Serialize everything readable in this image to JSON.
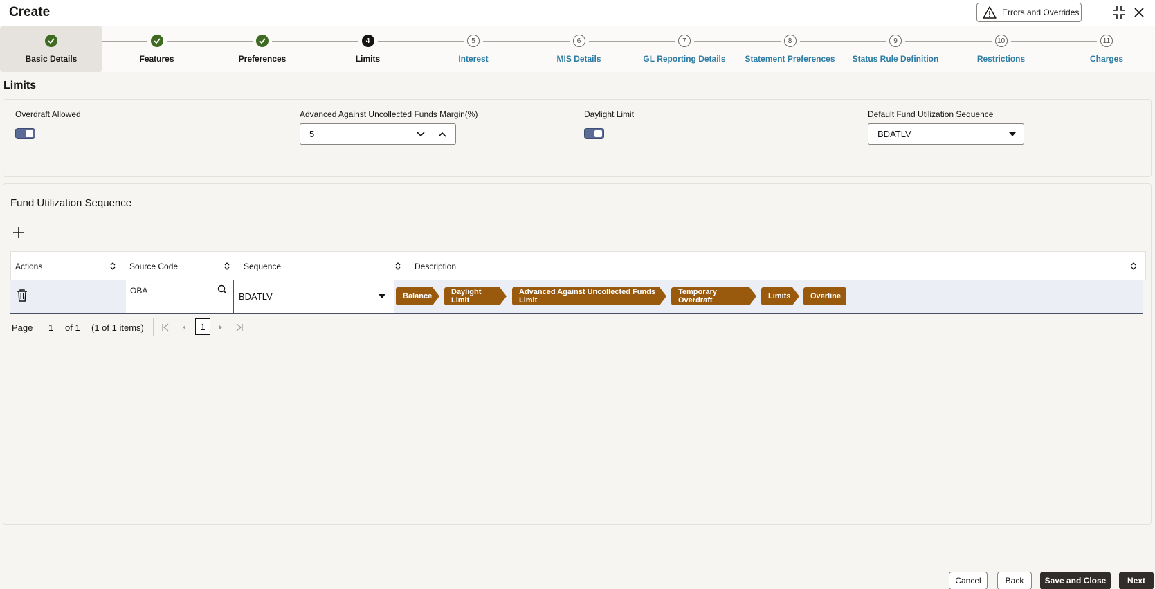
{
  "header": {
    "title": "Create",
    "errors_button": "Errors and Overrides"
  },
  "stepper": {
    "steps": [
      {
        "number": "",
        "label": "Basic Details",
        "state": "done"
      },
      {
        "number": "",
        "label": "Features",
        "state": "done"
      },
      {
        "number": "",
        "label": "Preferences",
        "state": "done"
      },
      {
        "number": "4",
        "label": "Limits",
        "state": "current"
      },
      {
        "number": "5",
        "label": "Interest",
        "state": "todo"
      },
      {
        "number": "6",
        "label": "MIS Details",
        "state": "todo"
      },
      {
        "number": "7",
        "label": "GL Reporting Details",
        "state": "todo"
      },
      {
        "number": "8",
        "label": "Statement Preferences",
        "state": "todo"
      },
      {
        "number": "9",
        "label": "Status Rule Definition",
        "state": "todo"
      },
      {
        "number": "10",
        "label": "Restrictions",
        "state": "todo"
      },
      {
        "number": "11",
        "label": "Charges",
        "state": "todo"
      }
    ]
  },
  "limits": {
    "title": "Limits",
    "overdraft_allowed_label": "Overdraft Allowed",
    "overdraft_allowed_on": true,
    "aucf_margin_label": "Advanced Against Uncollected Funds Margin(%)",
    "aucf_margin_value": "5",
    "daylight_limit_label": "Daylight Limit",
    "daylight_limit_on": true,
    "default_fus_label": "Default Fund Utilization Sequence",
    "default_fus_value": "BDATLV"
  },
  "fus": {
    "title": "Fund Utilization Sequence",
    "columns": [
      "Actions",
      "Source Code",
      "Sequence",
      "Description"
    ],
    "rows": [
      {
        "source_code": "OBA",
        "sequence": "BDATLV",
        "description": [
          "Balance",
          "Daylight Limit",
          "Advanced Against Uncollected Funds Limit",
          "Temporary Overdraft",
          "Limits",
          "Overline"
        ]
      }
    ],
    "pager": {
      "page_label": "Page",
      "page_value": "1",
      "of_label": "of 1",
      "items_label": "(1 of 1 items)",
      "current": "1"
    }
  },
  "footer": {
    "cancel": "Cancel",
    "back": "Back",
    "save_close": "Save and Close",
    "next": "Next"
  },
  "colors": {
    "done_step": "#3e6b21",
    "todo_label": "#2e7ca4",
    "chip": "#9a5a0e",
    "toggle": "#5a6b95",
    "primary_button": "#312d2a"
  }
}
